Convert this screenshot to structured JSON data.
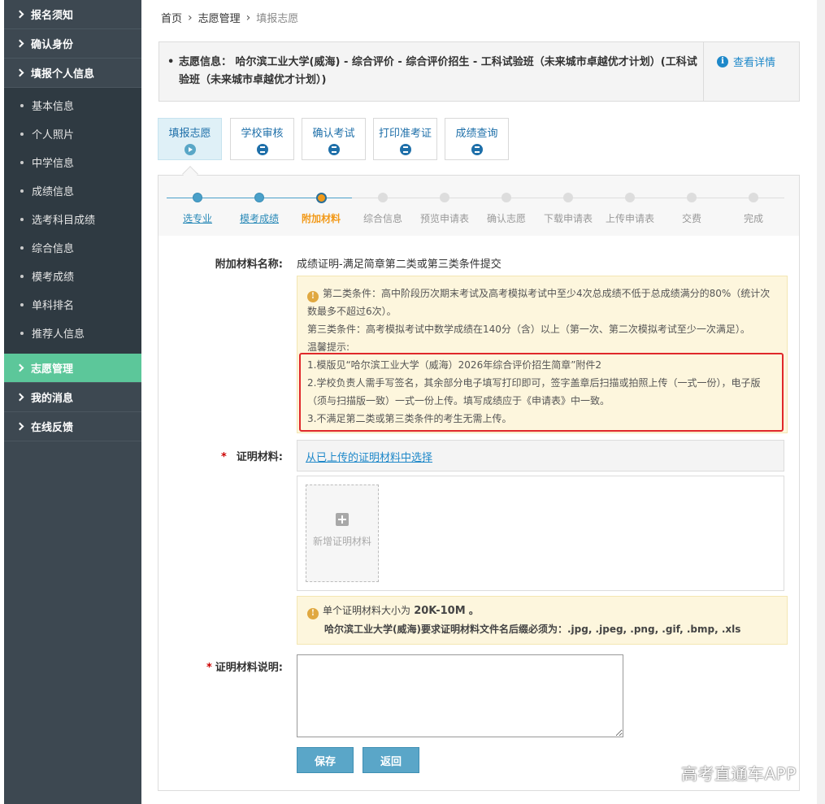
{
  "sidebar": {
    "top_items": [
      {
        "label": "报名须知"
      },
      {
        "label": "确认身份"
      },
      {
        "label": "填报个人信息"
      }
    ],
    "sub_items": [
      {
        "label": "基本信息"
      },
      {
        "label": "个人照片"
      },
      {
        "label": "中学信息"
      },
      {
        "label": "成绩信息"
      },
      {
        "label": "选考科目成绩"
      },
      {
        "label": "综合信息"
      },
      {
        "label": "模考成绩"
      },
      {
        "label": "单科排名"
      },
      {
        "label": "推荐人信息"
      }
    ],
    "bottom_items": [
      {
        "label": "志愿管理",
        "active": true
      },
      {
        "label": "我的消息"
      },
      {
        "label": "在线反馈"
      }
    ],
    "active_color": "#5cc79a"
  },
  "breadcrumb": {
    "home": "首页",
    "section": "志愿管理",
    "current": "填报志愿"
  },
  "info": {
    "label": "志愿信息：",
    "text": "哈尔滨工业大学(威海) - 综合评价 - 综合评价招生 - 工科试验班（未来城市卓越优才计划）(工科试验班（未来城市卓越优才计划）)",
    "detail_link": "查看详情"
  },
  "tabs": [
    {
      "label": "填报志愿",
      "active": true
    },
    {
      "label": "学校审核"
    },
    {
      "label": "确认考试"
    },
    {
      "label": "打印准考证"
    },
    {
      "label": "成绩查询"
    }
  ],
  "steps": [
    {
      "label": "选专业",
      "state": "done"
    },
    {
      "label": "模考成绩",
      "state": "done"
    },
    {
      "label": "附加材料",
      "state": "current"
    },
    {
      "label": "综合信息",
      "state": "todo"
    },
    {
      "label": "预览申请表",
      "state": "todo"
    },
    {
      "label": "确认志愿",
      "state": "todo"
    },
    {
      "label": "下载申请表",
      "state": "todo"
    },
    {
      "label": "上传申请表",
      "state": "todo"
    },
    {
      "label": "交费",
      "state": "todo"
    },
    {
      "label": "完成",
      "state": "todo"
    }
  ],
  "form": {
    "material_name_label": "附加材料名称:",
    "material_name_value": "成绩证明-满足简章第二类或第三类条件提交",
    "notice1": {
      "line1": "第二类条件：高中阶段历次期末考试及高考模拟考试中至少4次总成绩不低于总成绩满分的80%（统计次",
      "line1b": "数最多不超过6次）。",
      "line2": "第三类条件：高考模拟考试中数学成绩在140分（含）以上（第一次、第二次模拟考试至少一次满足）。",
      "line3": "温馨提示:",
      "tip1": "1.模版见“哈尔滨工业大学（威海）2026年综合评价招生简章”附件2",
      "tip2a": "2.学校负责人需手写签名，其余部分电子填写打印即可，签字盖章后扫描或拍照上传（一式一份），电子版",
      "tip2b": "（须与扫描版一致）一式一份上传。填写成绩应于《申请表》中一致。",
      "tip3": "3.不满足第二类或第三类条件的考生无需上传。"
    },
    "proof_label": "证明材料:",
    "choose_link": "从已上传的证明材料中选择",
    "add_material": "新增证明材料",
    "notice2": {
      "size_prefix": "单个证明材料大小为",
      "size_value": "20K-10M",
      "size_suffix": "。",
      "ext_text": "哈尔滨工业大学(威海)要求证明材料文件名后缀必须为：.jpg, .jpeg, .png, .gif, .bmp, .xls"
    },
    "desc_label": "证明材料说明:",
    "desc_value": "",
    "required_mark": "*",
    "save_button": "保存",
    "back_button": "返回"
  },
  "watermark": "高考直通车APP",
  "colors": {
    "accent_blue": "#1e88c9",
    "step_done": "#4aa0c9",
    "step_current": "#f29a1a",
    "notice_bg": "#fdf6dd",
    "highlight_border": "#e0282a"
  }
}
